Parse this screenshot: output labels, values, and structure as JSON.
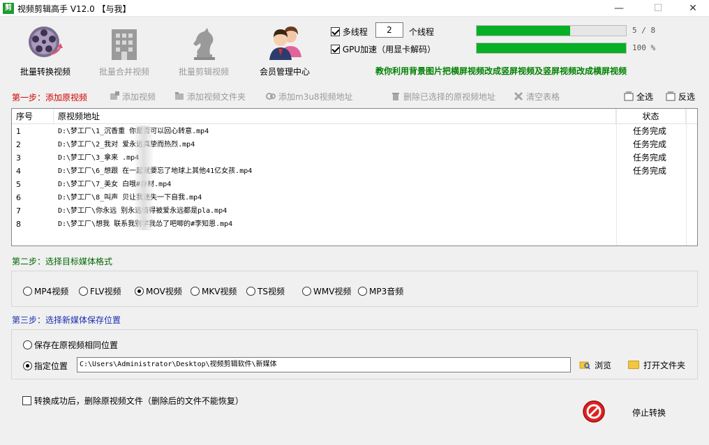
{
  "window": {
    "title": "视频剪辑高手 V12.0  【与我】",
    "logo": "logo-icon"
  },
  "toolbar": {
    "items": [
      {
        "label": "批量转换视频",
        "enabled": true,
        "icon": "film-reel-convert-icon"
      },
      {
        "label": "批量合并视频",
        "enabled": false,
        "icon": "building-merge-icon"
      },
      {
        "label": "批量剪辑视频",
        "enabled": false,
        "icon": "horse-chess-icon"
      },
      {
        "label": "会员管理中心",
        "enabled": true,
        "icon": "users-icon"
      }
    ]
  },
  "options": {
    "multithread_label": "多线程",
    "multithread_checked": true,
    "thread_count": "2",
    "thread_unit": "个线程",
    "gpu_label": "GPU加速（用显卡解码）",
    "gpu_checked": true
  },
  "progress": [
    {
      "text": "5 / 8",
      "fraction": 0.625
    },
    {
      "text": "100 %",
      "fraction": 1.0
    }
  ],
  "promo_text": "教你利用背景图片把横屏视频改成竖屏视频及竖屏视频改成横屏视频",
  "step1": {
    "title": "第一步：添加原视频",
    "actions": {
      "add_video": "添加视频",
      "add_folder": "添加视频文件夹",
      "add_m3u8": "添加m3u8视频地址",
      "delete_selected": "删除已选择的原视频地址",
      "clear_table": "清空表格",
      "select_all": "全选",
      "invert": "反选"
    }
  },
  "table": {
    "headers": {
      "no": "序号",
      "path": "原视频地址",
      "status": "状态"
    },
    "rows": [
      {
        "no": "1",
        "path": "D:\\梦工厂\\1_沉香重   你是否可以回心转意.mp4",
        "status": "任务完成"
      },
      {
        "no": "2",
        "path": "D:\\梦工厂\\2_我对   爱永远真挚而热烈.mp4",
        "status": "任务完成"
      },
      {
        "no": "3",
        "path": "D:\\梦工厂\\3_拿来    .mp4",
        "status": "任务完成"
      },
      {
        "no": "4",
        "path": "D:\\梦工厂\\6_想跟   在一起就要忘了地球上其他41亿女孩.mp4",
        "status": "任务完成"
      },
      {
        "no": "5",
        "path": "D:\\梦工厂\\7_美女   白哦#身材.mp4",
        "status": ""
      },
      {
        "no": "6",
        "path": "D:\\梦工厂\\8_叫声   贝让我迷失一下自我.mp4",
        "status": ""
      },
      {
        "no": "7",
        "path": "D:\\梦工厂\\你永远   别永远值得被爱永远都是pla.mp4",
        "status": ""
      },
      {
        "no": "8",
        "path": "D:\\梦工厂\\想我   联系我别学我怂了吧唧的#李知恩.mp4",
        "status": ""
      }
    ]
  },
  "step2": {
    "title": "第二步：选择目标媒体格式",
    "formats": [
      {
        "label": "MP4视频",
        "selected": false
      },
      {
        "label": "FLV视频",
        "selected": false
      },
      {
        "label": "MOV视频",
        "selected": true
      },
      {
        "label": "MKV视频",
        "selected": false
      },
      {
        "label": "TS视频",
        "selected": false
      },
      {
        "label": "WMV视频",
        "selected": false
      },
      {
        "label": "MP3音频",
        "selected": false
      }
    ]
  },
  "step3": {
    "title": "第三步：选择新媒体保存位置",
    "same_location_label": "保存在原视频相同位置",
    "same_location_selected": false,
    "custom_location_label": "指定位置",
    "custom_location_selected": true,
    "path_value": "C:\\Users\\Administrator\\Desktop\\视频剪辑软件\\新媒体",
    "browse_label": "浏览",
    "open_folder_label": "打开文件夹"
  },
  "delete_after": {
    "label": "转换成功后，删除原视频文件（删除后的文件不能恢复）",
    "checked": false
  },
  "stop": {
    "label": "停止转换",
    "icon": "stop-icon"
  }
}
